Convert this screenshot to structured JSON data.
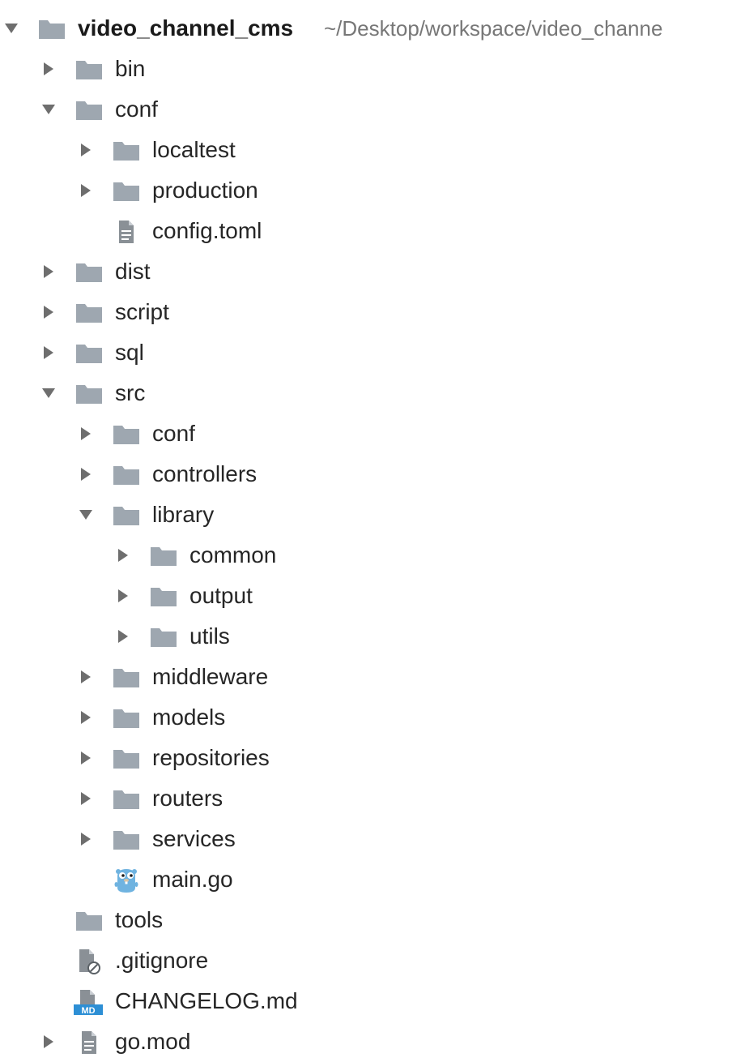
{
  "colors": {
    "folder": "#9ea7b0",
    "text": "#262626",
    "path_text": "#777777",
    "arrow": "#6e6e6e",
    "gopher": "#6fb3e0",
    "md_badge": "#2d8fd5"
  },
  "project": {
    "name": "video_channel_cms",
    "path": "~/Desktop/workspace/video_channe"
  },
  "tree": [
    {
      "label": "bin",
      "type": "folder",
      "depth": 1,
      "state": "collapsed"
    },
    {
      "label": "conf",
      "type": "folder",
      "depth": 1,
      "state": "expanded"
    },
    {
      "label": "localtest",
      "type": "folder",
      "depth": 2,
      "state": "collapsed"
    },
    {
      "label": "production",
      "type": "folder",
      "depth": 2,
      "state": "collapsed"
    },
    {
      "label": "config.toml",
      "type": "file-text",
      "depth": 2,
      "state": "none"
    },
    {
      "label": "dist",
      "type": "folder",
      "depth": 1,
      "state": "collapsed"
    },
    {
      "label": "script",
      "type": "folder",
      "depth": 1,
      "state": "collapsed"
    },
    {
      "label": "sql",
      "type": "folder",
      "depth": 1,
      "state": "collapsed"
    },
    {
      "label": "src",
      "type": "folder",
      "depth": 1,
      "state": "expanded"
    },
    {
      "label": "conf",
      "type": "folder",
      "depth": 2,
      "state": "collapsed"
    },
    {
      "label": "controllers",
      "type": "folder",
      "depth": 2,
      "state": "collapsed"
    },
    {
      "label": "library",
      "type": "folder",
      "depth": 2,
      "state": "expanded"
    },
    {
      "label": "common",
      "type": "folder",
      "depth": 3,
      "state": "collapsed"
    },
    {
      "label": "output",
      "type": "folder",
      "depth": 3,
      "state": "collapsed"
    },
    {
      "label": "utils",
      "type": "folder",
      "depth": 3,
      "state": "collapsed"
    },
    {
      "label": "middleware",
      "type": "folder",
      "depth": 2,
      "state": "collapsed"
    },
    {
      "label": "models",
      "type": "folder",
      "depth": 2,
      "state": "collapsed"
    },
    {
      "label": "repositories",
      "type": "folder",
      "depth": 2,
      "state": "collapsed"
    },
    {
      "label": "routers",
      "type": "folder",
      "depth": 2,
      "state": "collapsed"
    },
    {
      "label": "services",
      "type": "folder",
      "depth": 2,
      "state": "collapsed"
    },
    {
      "label": "main.go",
      "type": "file-go",
      "depth": 2,
      "state": "none"
    },
    {
      "label": "tools",
      "type": "folder",
      "depth": 1,
      "state": "none"
    },
    {
      "label": ".gitignore",
      "type": "file-ignored",
      "depth": 1,
      "state": "none"
    },
    {
      "label": "CHANGELOG.md",
      "type": "file-md",
      "depth": 1,
      "state": "none",
      "badge": "MD"
    },
    {
      "label": "go.mod",
      "type": "file-text",
      "depth": 1,
      "state": "collapsed"
    }
  ]
}
